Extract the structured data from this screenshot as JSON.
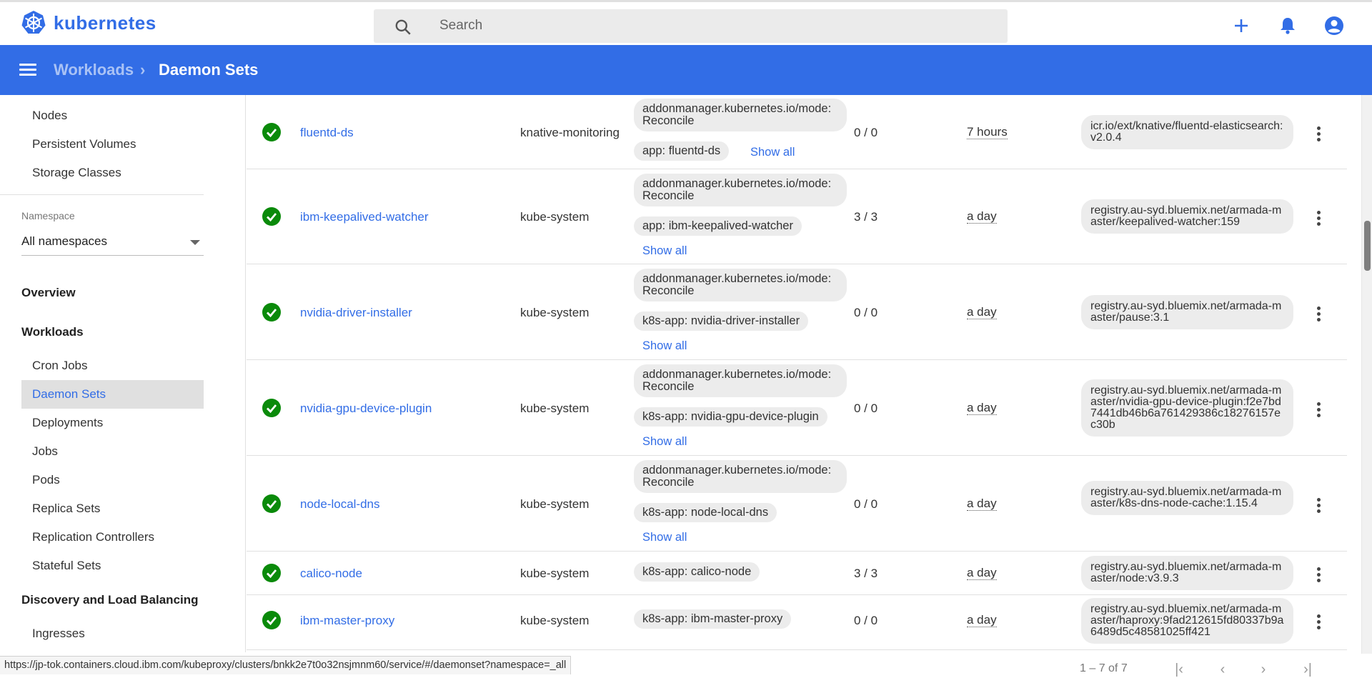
{
  "app": {
    "title": "kubernetes"
  },
  "search": {
    "placeholder": "Search"
  },
  "header_actions": {
    "create": "+",
    "notifications": "notifications",
    "account": "account"
  },
  "breadcrumb": {
    "parent": "Workloads",
    "separator": "›",
    "current": "Daemon Sets"
  },
  "sidebar": {
    "items_top": [
      "Nodes",
      "Persistent Volumes",
      "Storage Classes"
    ],
    "namespace_label": "Namespace",
    "namespace_value": "All namespaces",
    "overview": "Overview",
    "workloads": "Workloads",
    "workload_items": [
      "Cron Jobs",
      "Daemon Sets",
      "Deployments",
      "Jobs",
      "Pods",
      "Replica Sets",
      "Replication Controllers",
      "Stateful Sets"
    ],
    "discovery": "Discovery and Load Balancing",
    "discovery_items": [
      "Ingresses"
    ]
  },
  "rows": [
    {
      "name": "fluentd-ds",
      "namespace": "knative-monitoring",
      "labels": [
        "addonmanager.kubernetes.io/mode: Reconcile",
        "app: fluentd-ds"
      ],
      "show_all": "Show all",
      "pods": "0 / 0",
      "age": "7 hours",
      "image": "icr.io/ext/knative/fluentd-elasticsearch:v2.0.4"
    },
    {
      "name": "ibm-keepalived-watcher",
      "namespace": "kube-system",
      "labels": [
        "addonmanager.kubernetes.io/mode: Reconcile",
        "app: ibm-keepalived-watcher"
      ],
      "show_all": "Show all",
      "pods": "3 / 3",
      "age": "a day",
      "image": "registry.au-syd.bluemix.net/armada-master/keepalived-watcher:159"
    },
    {
      "name": "nvidia-driver-installer",
      "namespace": "kube-system",
      "labels": [
        "addonmanager.kubernetes.io/mode: Reconcile",
        "k8s-app: nvidia-driver-installer"
      ],
      "show_all": "Show all",
      "pods": "0 / 0",
      "age": "a day",
      "image": "registry.au-syd.bluemix.net/armada-master/pause:3.1"
    },
    {
      "name": "nvidia-gpu-device-plugin",
      "namespace": "kube-system",
      "labels": [
        "addonmanager.kubernetes.io/mode: Reconcile",
        "k8s-app: nvidia-gpu-device-plugin"
      ],
      "show_all": "Show all",
      "pods": "0 / 0",
      "age": "a day",
      "image": "registry.au-syd.bluemix.net/armada-master/nvidia-gpu-device-plugin:f2e7bd7441db46b6a761429386c18276157ec30b"
    },
    {
      "name": "node-local-dns",
      "namespace": "kube-system",
      "labels": [
        "addonmanager.kubernetes.io/mode: Reconcile",
        "k8s-app: node-local-dns"
      ],
      "show_all": "Show all",
      "pods": "0 / 0",
      "age": "a day",
      "image": "registry.au-syd.bluemix.net/armada-master/k8s-dns-node-cache:1.15.4"
    },
    {
      "name": "calico-node",
      "namespace": "kube-system",
      "labels": [
        "k8s-app: calico-node"
      ],
      "pods": "3 / 3",
      "age": "a day",
      "image": "registry.au-syd.bluemix.net/armada-master/node:v3.9.3"
    },
    {
      "name": "ibm-master-proxy",
      "namespace": "kube-system",
      "labels": [
        "k8s-app: ibm-master-proxy"
      ],
      "pods": "0 / 0",
      "age": "a day",
      "image": "registry.au-syd.bluemix.net/armada-master/haproxy:9fad212615fd80337b9a6489d5c48581025ff421"
    }
  ],
  "status_url": "https://jp-tok.containers.cloud.ibm.com/kubeproxy/clusters/bnkk2e7t0o32nsjmnm60/service/#/daemonset?namespace=_all",
  "pagination": {
    "range": "1 – 7 of 7",
    "first": "|‹",
    "prev": "‹",
    "next": "›",
    "last": "›|"
  },
  "colors": {
    "brand": "#326de6",
    "status_ok": "#0a8a0a"
  }
}
